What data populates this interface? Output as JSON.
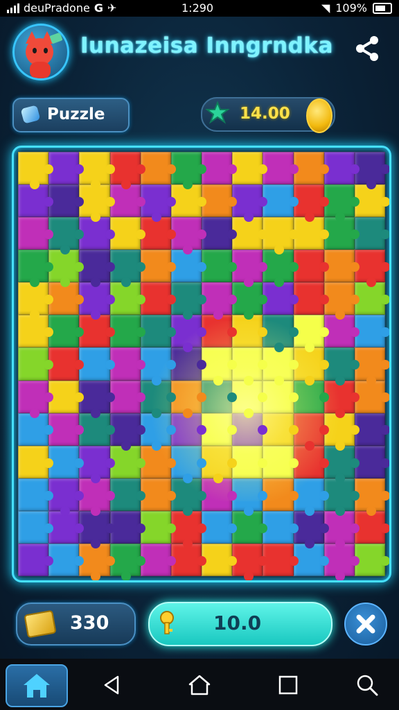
{
  "status_bar": {
    "carrier": "deuPradone",
    "app_icon": "G",
    "time": "1:290",
    "battery": "109%"
  },
  "header": {
    "title": "Iunazeisa Inngrndka",
    "share_icon": "share-icon",
    "mascot_icon": "fox-mascot-icon"
  },
  "mode_chip": {
    "label": "Puzzle",
    "icon": "gem-icon"
  },
  "coins": {
    "value": "14.00",
    "icon": "coin-icon",
    "badge_icon": "star-badge-icon"
  },
  "board": {
    "rows": 13,
    "cols": 12,
    "palette": [
      "#e8322f",
      "#7a2fd0",
      "#24a84a",
      "#2f9fe6",
      "#f5d21a",
      "#f28a1c",
      "#c02fb8",
      "#1d8a7c",
      "#85d62a",
      "#4a2a9a"
    ],
    "highlight_color": "#f5ff4a",
    "border_color": "#46e0ff"
  },
  "bottom_bar": {
    "left_value": "330",
    "left_icon": "gold-ticket-icon",
    "middle_value": "10.0",
    "middle_icon": "key-icon",
    "close_icon": "close-icon"
  },
  "nav": {
    "items": [
      "home-icon",
      "back-icon",
      "home-outline-icon",
      "recents-icon",
      "search-icon"
    ]
  }
}
